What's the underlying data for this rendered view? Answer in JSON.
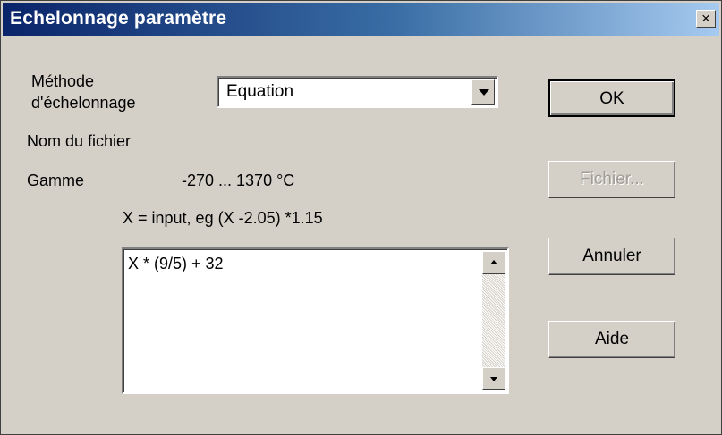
{
  "window": {
    "title": "Echelonnage paramètre",
    "close_label": "×"
  },
  "form": {
    "method_label_line1": "Méthode",
    "method_label_line2": "d'échelonnage",
    "method_value": "Equation",
    "filename_label": "Nom du fichier",
    "range_label": "Gamme",
    "range_value": "-270 ... 1370 °C",
    "hint": "X = input, eg (X -2.05) *1.15",
    "equation_text": "X * (9/5) + 32"
  },
  "buttons": {
    "ok": "OK",
    "file": "Fichier...",
    "cancel": "Annuler",
    "help": "Aide"
  },
  "colors": {
    "titlebar_start": "#0a246a",
    "titlebar_end": "#a6caf0",
    "dialog_background": "#d4d0c8"
  },
  "icons": {
    "close": "close-icon",
    "dropdown": "chevron-down-icon",
    "scroll_up": "scroll-up-icon",
    "scroll_down": "scroll-down-icon"
  }
}
